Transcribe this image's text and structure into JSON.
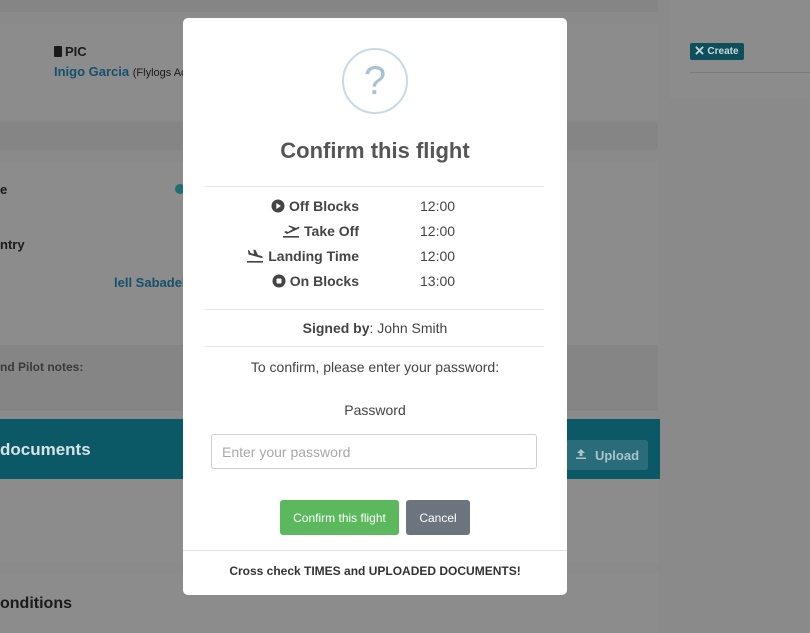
{
  "background": {
    "pic_label": "PIC",
    "pic_name": "Inigo Garcia",
    "pic_org": "(Flylogs Ac",
    "row_e": "e",
    "row_country": "ntry",
    "crew_name": "lell Sabadel",
    "notes_label": "nd Pilot notes:",
    "documents_title": "documents",
    "upload_label": "Upload",
    "conditions_title": "onditions",
    "create_label": "Create"
  },
  "modal": {
    "icon": "question-mark",
    "icon_glyph": "?",
    "title": "Confirm this flight",
    "times": [
      {
        "icon": "play-circle-icon",
        "label": "Off Blocks",
        "value": "12:00"
      },
      {
        "icon": "plane-departure-icon",
        "label": "Take Off",
        "value": "12:00"
      },
      {
        "icon": "plane-arrival-icon",
        "label": "Landing Time",
        "value": "12:00"
      },
      {
        "icon": "stop-circle-icon",
        "label": "On Blocks",
        "value": "13:00"
      }
    ],
    "signed_by_label": "Signed by",
    "signed_by_name": ": John Smith",
    "confirm_prompt": "To confirm, please enter your password:",
    "password_label": "Password",
    "password_placeholder": "Enter your password",
    "password_value": "",
    "confirm_button": "Confirm this flight",
    "cancel_button": "Cancel",
    "footer_note": "Cross check TIMES and UPLOADED DOCUMENTS!"
  },
  "colors": {
    "overlay": "#8a8a8a",
    "teal": "#0b5866",
    "success": "#5cb85c",
    "secondary": "#6c757d"
  }
}
